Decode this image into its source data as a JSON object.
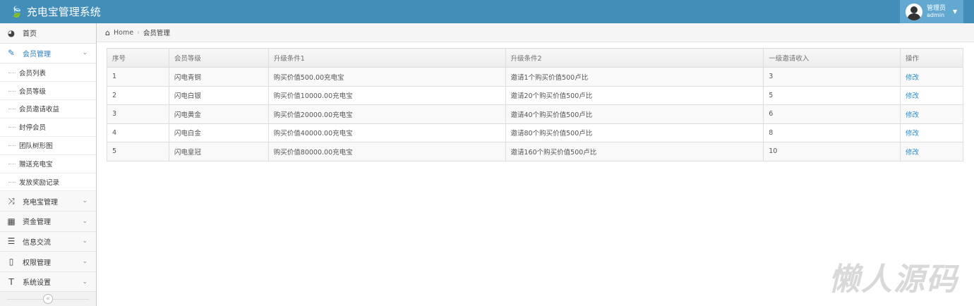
{
  "app": {
    "title": "充电宝管理系统",
    "user_role": "管理员",
    "user_name": "admin"
  },
  "sidebar": {
    "home": "首页",
    "member_mgmt": "会员管理",
    "sub": [
      "会员列表",
      "会员等级",
      "会员邀请收益",
      "封停会员",
      "团队树形图",
      "赠送充电宝",
      "发放奖励记录"
    ],
    "groups": [
      {
        "label": "充电宝管理",
        "icon": "shuffle-icon"
      },
      {
        "label": "资金管理",
        "icon": "calendar-icon"
      },
      {
        "label": "信息交流",
        "icon": "list-icon"
      },
      {
        "label": "权限管理",
        "icon": "file-icon"
      },
      {
        "label": "系统设置",
        "icon": "text-icon"
      }
    ]
  },
  "breadcrumb": {
    "home": "Home",
    "current": "会员管理"
  },
  "table": {
    "headers": [
      "序号",
      "会员等级",
      "升级条件1",
      "升级条件2",
      "一级邀请收入",
      "操作"
    ],
    "rows": [
      [
        "1",
        "闪电青铜",
        "购买价值500.00充电宝",
        "邀请1个购买价值500卢比",
        "3",
        "修改"
      ],
      [
        "2",
        "闪电白银",
        "购买价值10000.00充电宝",
        "邀请20个购买价值500卢比",
        "5",
        "修改"
      ],
      [
        "3",
        "闪电黄金",
        "购买价值20000.00充电宝",
        "邀请40个购买价值500卢比",
        "6",
        "修改"
      ],
      [
        "4",
        "闪电白金",
        "购买价值40000.00充电宝",
        "邀请80个购买价值500卢比",
        "8",
        "修改"
      ],
      [
        "5",
        "闪电皇冠",
        "购买价值80000.00充电宝",
        "邀请160个购买价值500卢比",
        "10",
        "修改"
      ]
    ]
  },
  "watermark": "懒人源码"
}
